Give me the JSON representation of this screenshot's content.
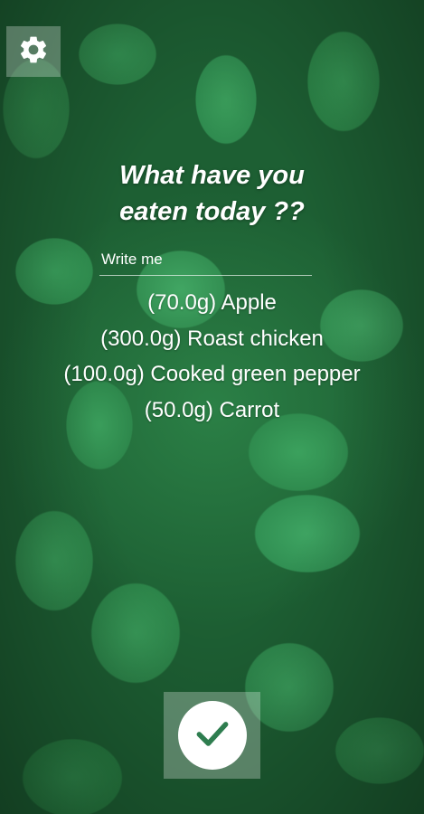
{
  "header": {
    "settings_icon": "gear-icon"
  },
  "main": {
    "title_line1": "What have you",
    "title_line2": "eaten today ??",
    "input": {
      "placeholder": "Write me",
      "value": ""
    },
    "food_items": [
      {
        "text": "(70.0g) Apple"
      },
      {
        "text": "(300.0g) Roast chicken"
      },
      {
        "text": "(100.0g) Cooked green pepper"
      },
      {
        "text": "(50.0g) Carrot"
      }
    ]
  },
  "footer": {
    "confirm_icon": "checkmark-icon"
  },
  "colors": {
    "accent": "#2e7d4f",
    "text": "#ffffff"
  }
}
